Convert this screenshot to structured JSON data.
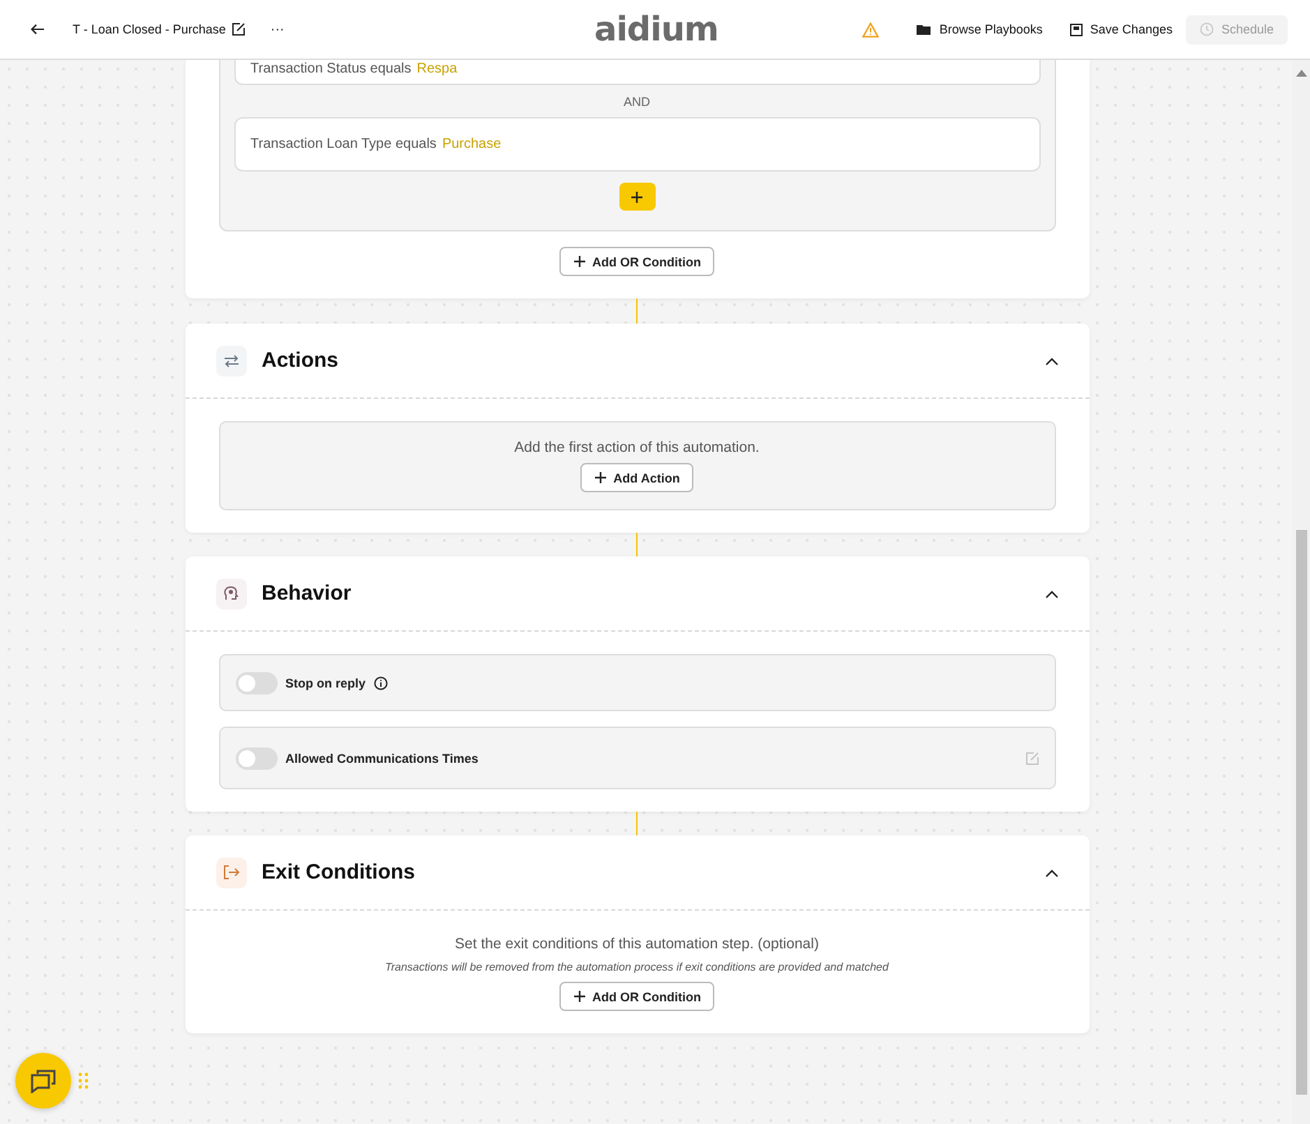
{
  "header": {
    "title": "T - Loan Closed - Purchase",
    "more": "···",
    "logo": "aidium",
    "buttons": [
      {
        "label": "Browse Playbooks",
        "kind": "folder",
        "disabled": false
      },
      {
        "label": "Save Changes",
        "kind": "save",
        "disabled": false
      },
      {
        "label": "Schedule",
        "kind": "clock",
        "disabled": true
      }
    ]
  },
  "trigger": {
    "conditions": [
      {
        "text": "Transaction Status equals",
        "value": "Respa"
      },
      {
        "text": "Transaction Loan Type equals",
        "value": "Purchase"
      }
    ],
    "joiner": "AND",
    "add_or": "Add OR Condition"
  },
  "actions": {
    "title": "Actions",
    "expanded": true,
    "message": "Add the first action of this automation.",
    "button": "Add Action"
  },
  "behavior": {
    "title": "Behavior",
    "expanded": true,
    "options": [
      {
        "label": "Stop on reply",
        "on": false,
        "kind": "info"
      },
      {
        "label": "Allowed Communications Times",
        "on": false,
        "kind": "edit"
      }
    ]
  },
  "exit": {
    "title": "Exit Conditions",
    "expanded": true,
    "message": "Set the exit conditions of this automation step. (optional)",
    "note": "Transactions will be removed from the automation process if exit conditions are provided and matched",
    "button": "Add OR Condition"
  }
}
